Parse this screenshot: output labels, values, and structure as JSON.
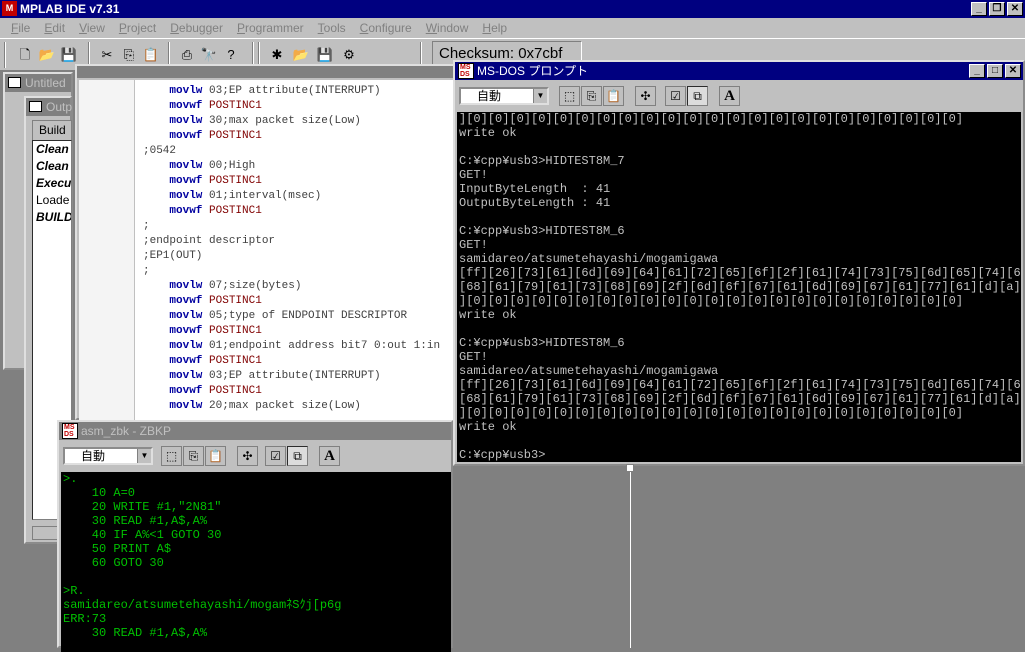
{
  "app": {
    "title": "MPLAB IDE v7.31",
    "logo_text": "M"
  },
  "menu": [
    {
      "id": "file",
      "label": "File"
    },
    {
      "id": "edit",
      "label": "Edit"
    },
    {
      "id": "view",
      "label": "View"
    },
    {
      "id": "project",
      "label": "Project"
    },
    {
      "id": "debugger",
      "label": "Debugger"
    },
    {
      "id": "programmer",
      "label": "Programmer"
    },
    {
      "id": "tools",
      "label": "Tools"
    },
    {
      "id": "configure",
      "label": "Configure"
    },
    {
      "id": "window",
      "label": "Window"
    },
    {
      "id": "help",
      "label": "Help"
    }
  ],
  "toolbar": {
    "checksum": "Checksum:  0x7cbf"
  },
  "project_window": {
    "title": "Untitled"
  },
  "output_window": {
    "title": "Outp",
    "tab": "Build",
    "lines": [
      {
        "text": "Clean",
        "style": "bi"
      },
      {
        "text": "Clean",
        "style": "bi"
      },
      {
        "text": "Execu",
        "style": "bi"
      },
      {
        "text": "Loade",
        "style": "normal"
      },
      {
        "text": "BUILD",
        "style": "bi"
      }
    ]
  },
  "asm": {
    "lines": [
      {
        "op": "movlw",
        "arg": "03;EP attribute(INTERRUPT)",
        "indent": 1
      },
      {
        "op": "movwf",
        "arg": "POSTINC1",
        "indent": 1
      },
      {
        "op": "movlw",
        "arg": "30;max packet size(Low)",
        "indent": 1
      },
      {
        "op": "movwf",
        "arg": "POSTINC1",
        "indent": 1
      },
      {
        "op": "",
        "arg": ";0542",
        "indent": 0
      },
      {
        "op": "movlw",
        "arg": "00;High",
        "indent": 1
      },
      {
        "op": "movwf",
        "arg": "POSTINC1",
        "indent": 1
      },
      {
        "op": "movlw",
        "arg": "01;interval(msec)",
        "indent": 1
      },
      {
        "op": "movwf",
        "arg": "POSTINC1",
        "indent": 1
      },
      {
        "op": "",
        "arg": ";",
        "indent": 0
      },
      {
        "op": "",
        "arg": ";endpoint descriptor",
        "indent": 0
      },
      {
        "op": "",
        "arg": ";EP1(OUT)",
        "indent": 0
      },
      {
        "op": "",
        "arg": ";",
        "indent": 0
      },
      {
        "op": "movlw",
        "arg": "07;size(bytes)",
        "indent": 1
      },
      {
        "op": "movwf",
        "arg": "POSTINC1",
        "indent": 1
      },
      {
        "op": "movlw",
        "arg": "05;type of ENDPOINT DESCRIPTOR",
        "indent": 1
      },
      {
        "op": "movwf",
        "arg": "POSTINC1",
        "indent": 1
      },
      {
        "op": "movlw",
        "arg": "01;endpoint address bit7 0:out 1:in",
        "indent": 1
      },
      {
        "op": "movwf",
        "arg": "POSTINC1",
        "indent": 1
      },
      {
        "op": "movlw",
        "arg": "03;EP attribute(INTERRUPT)",
        "indent": 1
      },
      {
        "op": "movwf",
        "arg": "POSTINC1",
        "indent": 1
      },
      {
        "op": "movlw",
        "arg": "20;max packet size(Low)",
        "indent": 1
      }
    ]
  },
  "dos": {
    "title": "MS-DOS プロンプト",
    "combo": "自動",
    "lines": [
      "][0][0][0][0][0][0][0][0][0][0][0][0][0][0][0][0][0][0][0][0][0][0][0]",
      "write ok",
      "",
      "C:¥cpp¥usb3>HIDTEST8M_7",
      "GET!",
      "InputByteLength  : 41",
      "OutputByteLength : 41",
      "",
      "C:¥cpp¥usb3>HIDTEST8M_6",
      "GET!",
      "samidareo/atsumetehayashi/mogamigawa",
      "[ff][26][73][61][6d][69][64][61][72][65][6f][2f][61][74][73][75][6d][65][74][65]",
      "[68][61][79][61][73][68][69][2f][6d][6f][67][61][6d][69][67][61][77][61][d][a][0",
      "][0][0][0][0][0][0][0][0][0][0][0][0][0][0][0][0][0][0][0][0][0][0][0]",
      "write ok",
      "",
      "C:¥cpp¥usb3>HIDTEST8M_6",
      "GET!",
      "samidareo/atsumetehayashi/mogamigawa",
      "[ff][26][73][61][6d][69][64][61][72][65][6f][2f][61][74][73][75][6d][65][74][65]",
      "[68][61][79][61][73][68][69][2f][6d][6f][67][61][6d][69][67][61][77][61][d][a][0",
      "][0][0][0][0][0][0][0][0][0][0][0][0][0][0][0][0][0][0][0][0][0][0][0]",
      "write ok",
      "",
      "C:¥cpp¥usb3>"
    ]
  },
  "zbk": {
    "title": "asm_zbk - ZBKP",
    "combo": "自動",
    "lines": [
      ">.",
      "    10 A=0",
      "    20 WRITE #1,\"2N81\"",
      "    30 READ #1,A$,A%",
      "    40 IF A%<1 GOTO 30",
      "    50 PRINT A$",
      "    60 GOTO 30",
      "",
      ">R.",
      "samidareo/atsumetehayashi/mogamﾈSｸj[p6g",
      "ERR:73",
      "    30 READ #1,A$,A%",
      "",
      ">",
      ">"
    ]
  },
  "colors": {
    "active_caption": "#000080",
    "inactive_caption": "#808080",
    "face": "#c0c0c0",
    "dos_text": "#c0c0c0",
    "zbk_text": "#00c000"
  }
}
